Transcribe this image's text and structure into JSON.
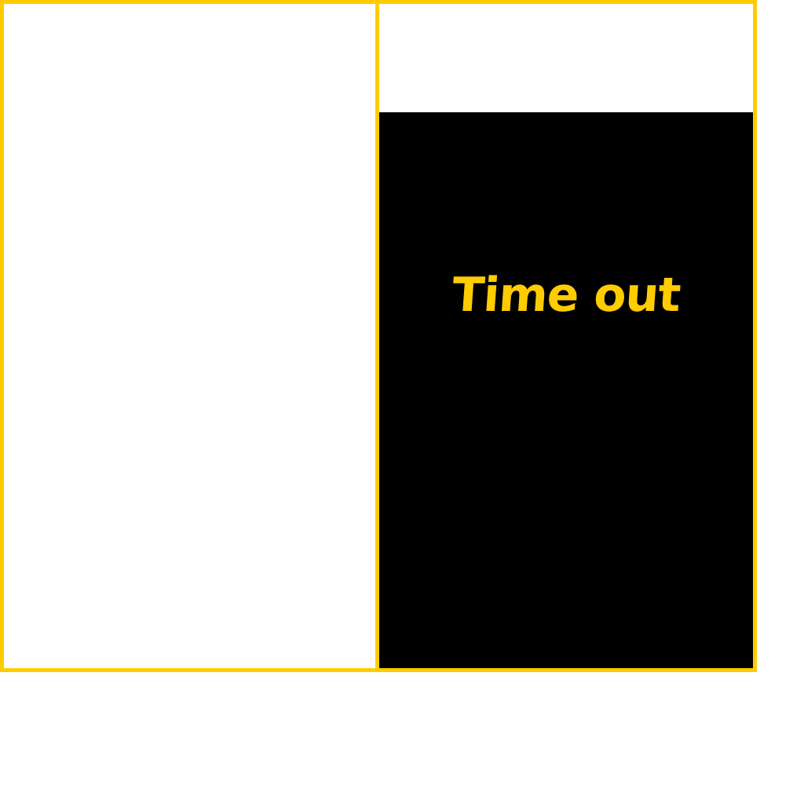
{
  "colors": {
    "accent": "#FFCC00",
    "screen_background": "#000000",
    "page_background": "#FFFFFF"
  },
  "status": {
    "message": "Time out"
  }
}
